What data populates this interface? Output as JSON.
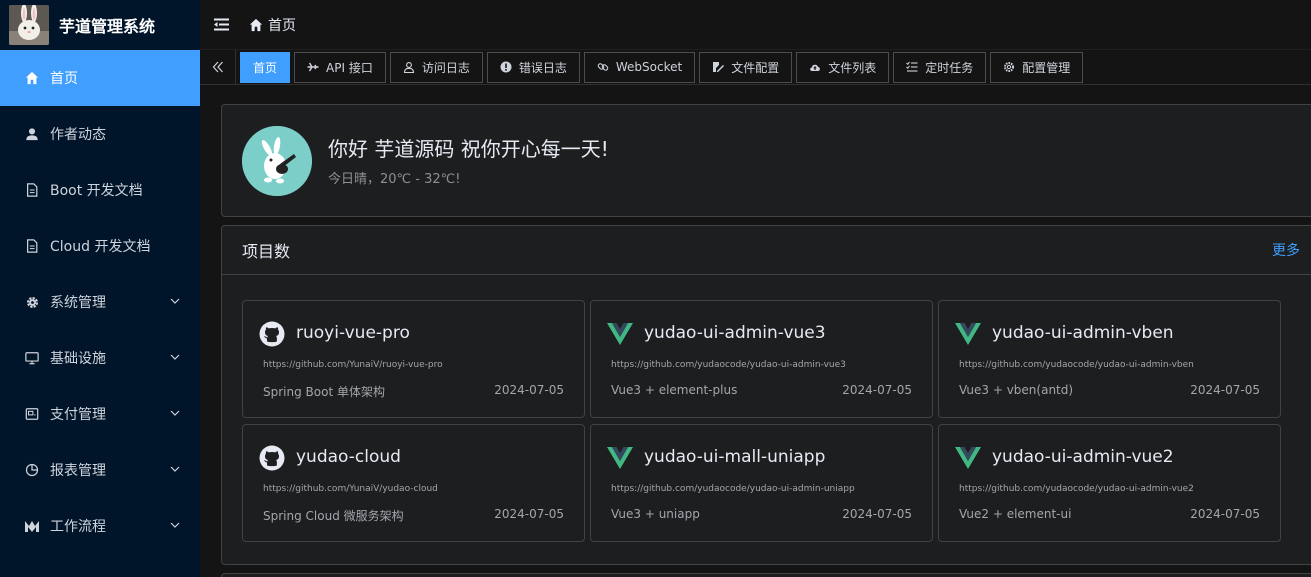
{
  "app": {
    "title": "芋道管理系统"
  },
  "sidebar": {
    "items": [
      {
        "label": "首页",
        "icon": "home-icon",
        "active": true
      },
      {
        "label": "作者动态",
        "icon": "user-icon"
      },
      {
        "label": "Boot 开发文档",
        "icon": "document-icon"
      },
      {
        "label": "Cloud 开发文档",
        "icon": "document-icon"
      },
      {
        "label": "系统管理",
        "icon": "gear-icon",
        "expandable": true
      },
      {
        "label": "基础设施",
        "icon": "monitor-icon",
        "expandable": true
      },
      {
        "label": "支付管理",
        "icon": "payment-icon",
        "expandable": true
      },
      {
        "label": "报表管理",
        "icon": "pie-chart-icon",
        "expandable": true
      },
      {
        "label": "工作流程",
        "icon": "workflow-icon",
        "expandable": true
      }
    ]
  },
  "header": {
    "breadcrumb": "首页"
  },
  "tags": [
    {
      "label": "首页",
      "active": true
    },
    {
      "label": "API 接口",
      "icon": "plane-icon"
    },
    {
      "label": "访问日志",
      "icon": "user-icon"
    },
    {
      "label": "错误日志",
      "icon": "alert-icon"
    },
    {
      "label": "WebSocket",
      "icon": "link-icon"
    },
    {
      "label": "文件配置",
      "icon": "edit-icon"
    },
    {
      "label": "文件列表",
      "icon": "cloud-upload-icon"
    },
    {
      "label": "定时任务",
      "icon": "list-check-icon"
    },
    {
      "label": "配置管理",
      "icon": "settings-icon"
    }
  ],
  "welcome": {
    "greeting": "你好 芋道源码 祝你开心每一天!",
    "weather": "今日晴，20℃ - 32℃!"
  },
  "projects": {
    "title": "项目数",
    "more": "更多",
    "items": [
      {
        "name": "ruoyi-vue-pro",
        "icon": "github-icon",
        "url": "https://github.com/YunaiV/ruoyi-vue-pro",
        "desc": "Spring Boot 单体架构",
        "date": "2024-07-05"
      },
      {
        "name": "yudao-ui-admin-vue3",
        "icon": "vue-icon",
        "url": "https://github.com/yudaocode/yudao-ui-admin-vue3",
        "desc": "Vue3 + element-plus",
        "date": "2024-07-05"
      },
      {
        "name": "yudao-ui-admin-vben",
        "icon": "vue-icon",
        "url": "https://github.com/yudaocode/yudao-ui-admin-vben",
        "desc": "Vue3 + vben(antd)",
        "date": "2024-07-05"
      },
      {
        "name": "yudao-cloud",
        "icon": "github-icon",
        "url": "https://github.com/YunaiV/yudao-cloud",
        "desc": "Spring Cloud 微服务架构",
        "date": "2024-07-05"
      },
      {
        "name": "yudao-ui-mall-uniapp",
        "icon": "vue-icon",
        "url": "https://github.com/yudaocode/yudao-ui-admin-uniapp",
        "desc": "Vue3 + uniapp",
        "date": "2024-07-05"
      },
      {
        "name": "yudao-ui-admin-vue2",
        "icon": "vue-icon",
        "url": "https://github.com/yudaocode/yudao-ui-admin-vue2",
        "desc": "Vue2 + element-ui",
        "date": "2024-07-05"
      }
    ]
  },
  "colors": {
    "sidebar_bg": "#001529",
    "accent": "#409eff",
    "page_bg": "#141414",
    "card_bg": "#1d1e1f",
    "vue_green": "#41b883",
    "vue_dark": "#35495e"
  }
}
